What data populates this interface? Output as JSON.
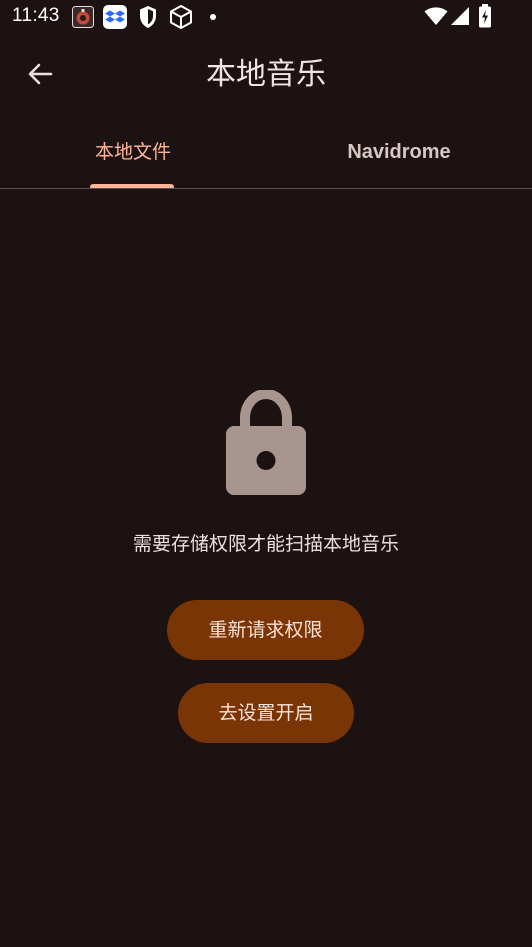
{
  "status_bar": {
    "time": "11:43",
    "icons": [
      "app-notification-icon",
      "dropbox-icon",
      "shield-icon",
      "cube-icon",
      "dot-icon",
      "wifi-icon",
      "cell-signal-icon",
      "battery-charging-icon"
    ]
  },
  "header": {
    "title": "本地音乐",
    "back_icon": "arrow-back-icon"
  },
  "tabs": [
    {
      "label": "本地文件",
      "selected": true
    },
    {
      "label": "Navidrome",
      "selected": false
    }
  ],
  "empty_state": {
    "icon": "lock-icon",
    "message": "需要存储权限才能扫描本地音乐"
  },
  "buttons": {
    "retry_label": "重新请求权限",
    "settings_label": "去设置开启"
  },
  "colors": {
    "background": "#1c1212",
    "accent": "#ffb59a",
    "button_fill": "#7a3507",
    "button_text": "#ffe2d6",
    "lock_icon": "#a8958f"
  }
}
